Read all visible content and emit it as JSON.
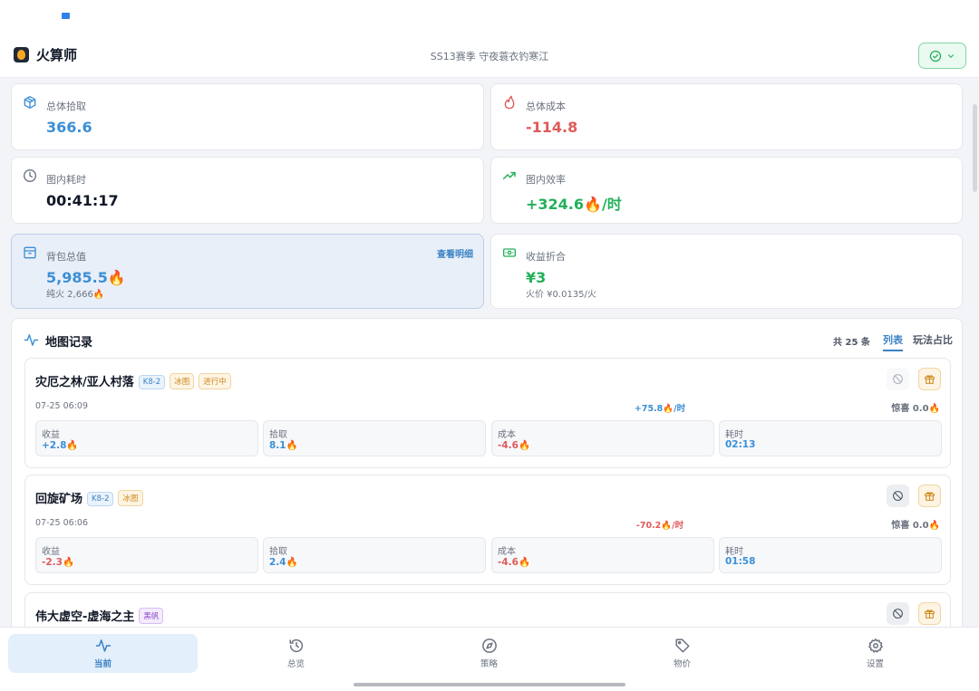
{
  "app": {
    "title": "火算师",
    "season": "SS13赛季  守夜蓑衣钓寒江"
  },
  "stats": {
    "total_pickup": {
      "label": "总体拾取",
      "value": "366.6"
    },
    "total_cost": {
      "label": "总体成本",
      "value": "-114.8"
    },
    "map_time": {
      "label": "图内耗时",
      "value": "00:41:17"
    },
    "map_efficiency": {
      "label": "图内效率",
      "value": "+324.6🔥/时"
    },
    "bag_value": {
      "label": "背包总值",
      "value": "5,985.5🔥",
      "sub": "纯火 2,666🔥",
      "link": "查看明细"
    },
    "earnings_cash": {
      "label": "收益折合",
      "value": "¥3",
      "sub": "火价 ¥0.0135/火"
    }
  },
  "records": {
    "title": "地图记录",
    "count": "共 25 条",
    "tabs": {
      "list": "列表",
      "ratio": "玩法占比"
    },
    "items": [
      {
        "name": "灾厄之林/亚人村落",
        "badges": {
          "level": "K8-2",
          "ice": "冰图",
          "live": "进行中"
        },
        "time": "07-25 06:09",
        "rate": "+75.8🔥/时",
        "surprise": "惊喜 0.0🔥",
        "metrics": {
          "income": {
            "label": "收益",
            "value": "+2.8🔥"
          },
          "pickup": {
            "label": "拾取",
            "value": "8.1🔥"
          },
          "cost": {
            "label": "成本",
            "value": "-4.6🔥"
          },
          "duration": {
            "label": "耗时",
            "value": "02:13"
          }
        }
      },
      {
        "name": "回旋矿场",
        "badges": {
          "level": "K8-2",
          "ice": "冰图"
        },
        "time": "07-25 06:06",
        "rate": "-70.2🔥/时",
        "surprise": "惊喜 0.0🔥",
        "metrics": {
          "income": {
            "label": "收益",
            "value": "-2.3🔥"
          },
          "pickup": {
            "label": "拾取",
            "value": "2.4🔥"
          },
          "cost": {
            "label": "成本",
            "value": "-4.6🔥"
          },
          "duration": {
            "label": "耗时",
            "value": "01:58"
          }
        }
      },
      {
        "name": "伟大虚空-虚海之主",
        "badges": {
          "black": "黑帆"
        }
      }
    ]
  },
  "nav": {
    "current": "当前",
    "overview": "总览",
    "strategy": "策略",
    "price": "物价",
    "settings": "设置"
  },
  "colors": {
    "accent": "#3b82c4",
    "positive": "#22b05a",
    "negative": "#e05a5a",
    "warning": "#d08a1f"
  }
}
